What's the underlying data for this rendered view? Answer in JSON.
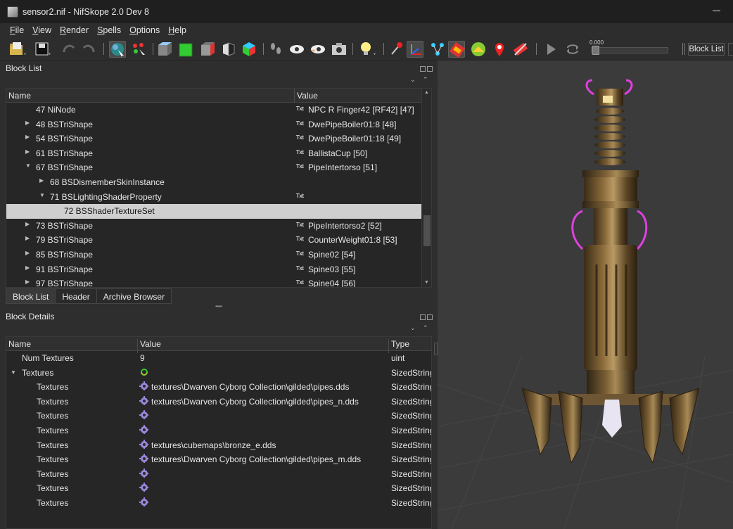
{
  "window": {
    "title": "sensor2.nif - NifSkope 2.0 Dev 8"
  },
  "menu": [
    "File",
    "View",
    "Render",
    "Spells",
    "Options",
    "Help"
  ],
  "toolbar": {
    "slider_value": "0.000",
    "block_list_button": "Block List",
    "icons": [
      "open-file-icon",
      "save-icon",
      "undo-icon",
      "redo-icon",
      "select-object-icon",
      "select-vertices-icon",
      "view-top-icon",
      "view-front-icon",
      "view-side-icon",
      "view-flip-icon",
      "view-user-icon",
      "walk-icon",
      "view-eye-icon",
      "flip-eye-icon",
      "screenshot-icon",
      "light-bulb-icon",
      "axes-toggle-icon",
      "move-gizmo-icon",
      "nodes-icon",
      "textures-icon",
      "vertex-colors-icon",
      "markers-icon",
      "collision-icon",
      "play-icon",
      "loop-icon"
    ]
  },
  "block_list": {
    "title": "Block List",
    "columns": {
      "name": "Name",
      "value": "Value"
    },
    "rows": [
      {
        "name": "47 NiNode",
        "value": "NPC R Finger42 [RF42] [47]",
        "indent": 0,
        "arrow": "",
        "txt": true
      },
      {
        "name": "48 BSTriShape",
        "value": "DwePipeBoiler01:8 [48]",
        "indent": 0,
        "arrow": "▶",
        "txt": true
      },
      {
        "name": "54 BSTriShape",
        "value": "DwePipeBoiler01:18 [49]",
        "indent": 0,
        "arrow": "▶",
        "txt": true
      },
      {
        "name": "61 BSTriShape",
        "value": "BallistaCup [50]",
        "indent": 0,
        "arrow": "▶",
        "txt": true
      },
      {
        "name": "67 BSTriShape",
        "value": "PipeIntertorso [51]",
        "indent": 0,
        "arrow": "▼",
        "txt": true
      },
      {
        "name": "68 BSDismemberSkinInstance",
        "value": "",
        "indent": 1,
        "arrow": "▶",
        "txt": false
      },
      {
        "name": "71 BSLightingShaderProperty",
        "value": "",
        "indent": 1,
        "arrow": "▼",
        "txt": true
      },
      {
        "name": "72 BSShaderTextureSet",
        "value": "",
        "indent": 2,
        "arrow": "",
        "txt": false,
        "selected": true
      },
      {
        "name": "73 BSTriShape",
        "value": "PipeIntertorso2 [52]",
        "indent": 0,
        "arrow": "▶",
        "txt": true
      },
      {
        "name": "79 BSTriShape",
        "value": "CounterWeight01:8 [53]",
        "indent": 0,
        "arrow": "▶",
        "txt": true
      },
      {
        "name": "85 BSTriShape",
        "value": "Spine02 [54]",
        "indent": 0,
        "arrow": "▶",
        "txt": true
      },
      {
        "name": "91 BSTriShape",
        "value": "Spine03 [55]",
        "indent": 0,
        "arrow": "▶",
        "txt": true
      },
      {
        "name": "97 BSTriShape",
        "value": "Spine04 [56]",
        "indent": 0,
        "arrow": "▶",
        "txt": true
      }
    ],
    "txt_badge": "Txt"
  },
  "tabs": [
    "Block List",
    "Header",
    "Archive Browser"
  ],
  "block_details": {
    "title": "Block Details",
    "columns": {
      "name": "Name",
      "value": "Value",
      "type": "Type"
    },
    "rows": [
      {
        "name": "Num Textures",
        "value": "9",
        "type": "uint",
        "indent": 0,
        "icon": ""
      },
      {
        "name": "Textures",
        "value": "",
        "type": "SizedString",
        "indent": 0,
        "icon": "refresh",
        "arrow": "▼"
      },
      {
        "name": "Textures",
        "value": "textures\\Dwarven Cyborg Collection\\gilded\\pipes.dds",
        "type": "SizedString",
        "indent": 1,
        "icon": "gear"
      },
      {
        "name": "Textures",
        "value": "textures\\Dwarven Cyborg Collection\\gilded\\pipes_n.dds",
        "type": "SizedString",
        "indent": 1,
        "icon": "gear"
      },
      {
        "name": "Textures",
        "value": "",
        "type": "SizedString",
        "indent": 1,
        "icon": "gear"
      },
      {
        "name": "Textures",
        "value": "",
        "type": "SizedString",
        "indent": 1,
        "icon": "gear"
      },
      {
        "name": "Textures",
        "value": "textures\\cubemaps\\bronze_e.dds",
        "type": "SizedString",
        "indent": 1,
        "icon": "gear"
      },
      {
        "name": "Textures",
        "value": "textures\\Dwarven Cyborg Collection\\gilded\\pipes_m.dds",
        "type": "SizedString",
        "indent": 1,
        "icon": "gear"
      },
      {
        "name": "Textures",
        "value": "",
        "type": "SizedString",
        "indent": 1,
        "icon": "gear"
      },
      {
        "name": "Textures",
        "value": "",
        "type": "SizedString",
        "indent": 1,
        "icon": "gear"
      },
      {
        "name": "Textures",
        "value": "",
        "type": "SizedString",
        "indent": 1,
        "icon": "gear"
      }
    ]
  },
  "viewport": {
    "colors": {
      "background": "#3b3b3b",
      "glow": "#e040e0",
      "metal": "#8a6a3a"
    }
  }
}
